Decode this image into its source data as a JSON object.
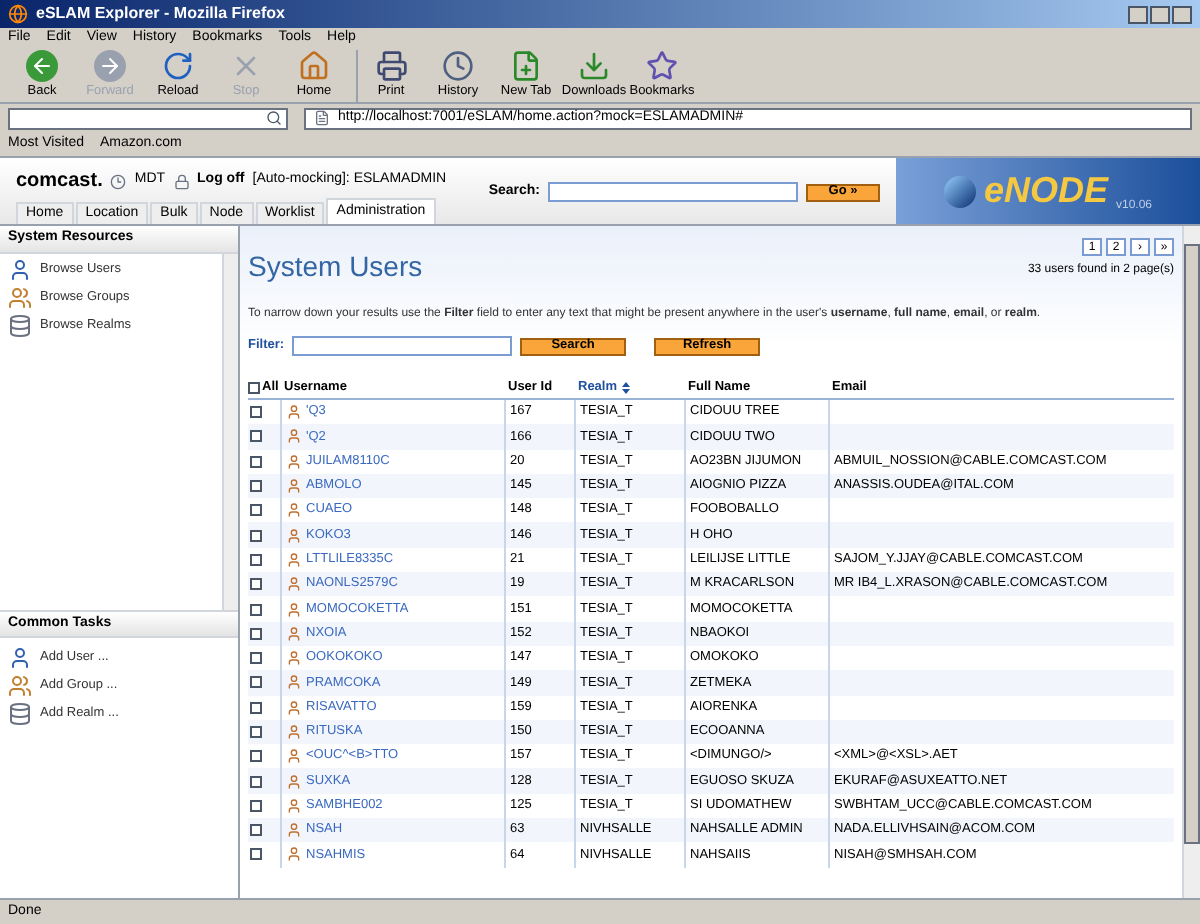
{
  "window": {
    "title": "eSLAM Explorer - Mozilla Firefox"
  },
  "menu": [
    "File",
    "Edit",
    "View",
    "History",
    "Bookmarks",
    "Tools",
    "Help"
  ],
  "toolbar": [
    {
      "label": "Back",
      "kind": "back",
      "disabled": false
    },
    {
      "label": "Forward",
      "kind": "forward",
      "disabled": true
    },
    {
      "label": "Reload",
      "kind": "reload",
      "disabled": false
    },
    {
      "label": "Stop",
      "kind": "stop",
      "disabled": true
    },
    {
      "label": "Home",
      "kind": "home",
      "disabled": false
    },
    {
      "label": "Print",
      "kind": "print",
      "disabled": false
    },
    {
      "label": "History",
      "kind": "history",
      "disabled": false
    },
    {
      "label": "New Tab",
      "kind": "newtab",
      "disabled": false
    },
    {
      "label": "Downloads",
      "kind": "downloads",
      "disabled": false
    },
    {
      "label": "Bookmarks",
      "kind": "bookmarks",
      "disabled": false
    }
  ],
  "address": "http://localhost:7001/eSLAM/home.action?mock=ESLAMADMIN#",
  "bookmarks_bar": [
    "Most Visited",
    "Amazon.com"
  ],
  "header": {
    "logo": "comcast.",
    "timezone": "MDT",
    "logoff": "Log off",
    "user": "[Auto-mocking]: ESLAMADMIN",
    "search_label": "Search:",
    "go": "Go »",
    "brand": "eNODE",
    "version": "v10.06"
  },
  "tabs": [
    {
      "label": "Home",
      "selected": false
    },
    {
      "label": "Location",
      "selected": false
    },
    {
      "label": "Bulk",
      "selected": false
    },
    {
      "label": "Node",
      "selected": false
    },
    {
      "label": "Worklist",
      "selected": false
    },
    {
      "label": "Administration",
      "selected": true
    }
  ],
  "sidebar": {
    "title": "System Resources",
    "items": [
      {
        "label": "Browse Users",
        "kind": "user"
      },
      {
        "label": "Browse Groups",
        "kind": "group"
      },
      {
        "label": "Browse Realms",
        "kind": "realm"
      }
    ],
    "tasks_title": "Common Tasks",
    "tasks": [
      {
        "label": "Add User ...",
        "kind": "user"
      },
      {
        "label": "Add Group ...",
        "kind": "group"
      },
      {
        "label": "Add Realm ...",
        "kind": "realm"
      }
    ]
  },
  "main": {
    "title": "System Users",
    "pager": [
      "1",
      "2",
      "›",
      "»"
    ],
    "found": "33 users found in 2 page(s)",
    "hint": "To narrow down your results use the **Filter** field to enter any text that might be present anywhere in the user's **username**, **full name**, **email**, or **realm**.",
    "filter_label": "Filter:",
    "search": "Search",
    "refresh": "Refresh",
    "table": {
      "all": "All",
      "all_checked": false,
      "columns": [
        "Username",
        "User Id",
        "Realm",
        "Full Name",
        "Email"
      ],
      "rows": [
        {
          "checked": false,
          "cells": [
            "'Q3",
            "167",
            "TESIA_T",
            "CIDOUU TREE",
            ""
          ]
        },
        {
          "checked": false,
          "cells": [
            "'Q2",
            "166",
            "TESIA_T",
            "CIDOUU TWO",
            ""
          ]
        },
        {
          "checked": false,
          "cells": [
            "JUILAM8110C",
            "20",
            "TESIA_T",
            "AO23BN JIJUMON",
            "ABMUIL_NOSSION@CABLE.COMCAST.COM"
          ]
        },
        {
          "checked": false,
          "cells": [
            "ABMOLO",
            "145",
            "TESIA_T",
            "AIOGNIO PIZZA",
            "ANASSIS.OUDEA@ITAL.COM"
          ]
        },
        {
          "checked": false,
          "cells": [
            "CUAEO",
            "148",
            "TESIA_T",
            "FOOBOBALLO",
            ""
          ]
        },
        {
          "checked": false,
          "cells": [
            "KOKO3",
            "146",
            "TESIA_T",
            "H OHO",
            ""
          ]
        },
        {
          "checked": false,
          "cells": [
            "LTTLILE8335C",
            "21",
            "TESIA_T",
            "LEILIJSE LITTLE",
            "SAJOM_Y.JJAY@CABLE.COMCAST.COM"
          ]
        },
        {
          "checked": false,
          "cells": [
            "NAONLS2579C",
            "19",
            "TESIA_T",
            "M KRACARLSON",
            "MR IB4_L.XRASON@CABLE.COMCAST.COM"
          ]
        },
        {
          "checked": false,
          "cells": [
            "MOMOCOKETTA",
            "151",
            "TESIA_T",
            "MOMOCOKETTA",
            ""
          ]
        },
        {
          "checked": false,
          "cells": [
            "NXOIA",
            "152",
            "TESIA_T",
            "NBAOKOI",
            ""
          ]
        },
        {
          "checked": false,
          "cells": [
            "OOKOKOKO",
            "147",
            "TESIA_T",
            "OMOKOKO",
            ""
          ]
        },
        {
          "checked": false,
          "cells": [
            "PRAMCOKA",
            "149",
            "TESIA_T",
            "ZETMEKA",
            ""
          ]
        },
        {
          "checked": false,
          "cells": [
            "RISAVATTO",
            "159",
            "TESIA_T",
            "AIORENKA",
            ""
          ]
        },
        {
          "checked": false,
          "cells": [
            "RITUSKA",
            "150",
            "TESIA_T",
            "ECOOANNA",
            ""
          ]
        },
        {
          "checked": false,
          "cells": [
            "<OUC^<B>TTO",
            "157",
            "TESIA_T",
            "<DIMUNGO/>",
            "<XML>@<XSL>.AET"
          ]
        },
        {
          "checked": false,
          "cells": [
            "SUXKA",
            "128",
            "TESIA_T",
            "EGUOSO SKUZA",
            "EKURAF@ASUXEATTO.NET"
          ]
        },
        {
          "checked": false,
          "cells": [
            "SAMBHE002",
            "125",
            "TESIA_T",
            "SI UDOMATHEW",
            "SWBHTAM_UCC@CABLE.COMCAST.COM"
          ]
        },
        {
          "checked": false,
          "cells": [
            "NSAH",
            "63",
            "NIVHSALLE",
            "NAHSALLE ADMIN",
            "NADA.ELLIVHSAIN@ACOM.COM"
          ]
        },
        {
          "checked": false,
          "cells": [
            "NSAHMIS",
            "64",
            "NIVHSALLE",
            "NAHSAIIS",
            "NISAH@SMHSAH.COM"
          ]
        }
      ]
    }
  },
  "status_bar": "Done"
}
